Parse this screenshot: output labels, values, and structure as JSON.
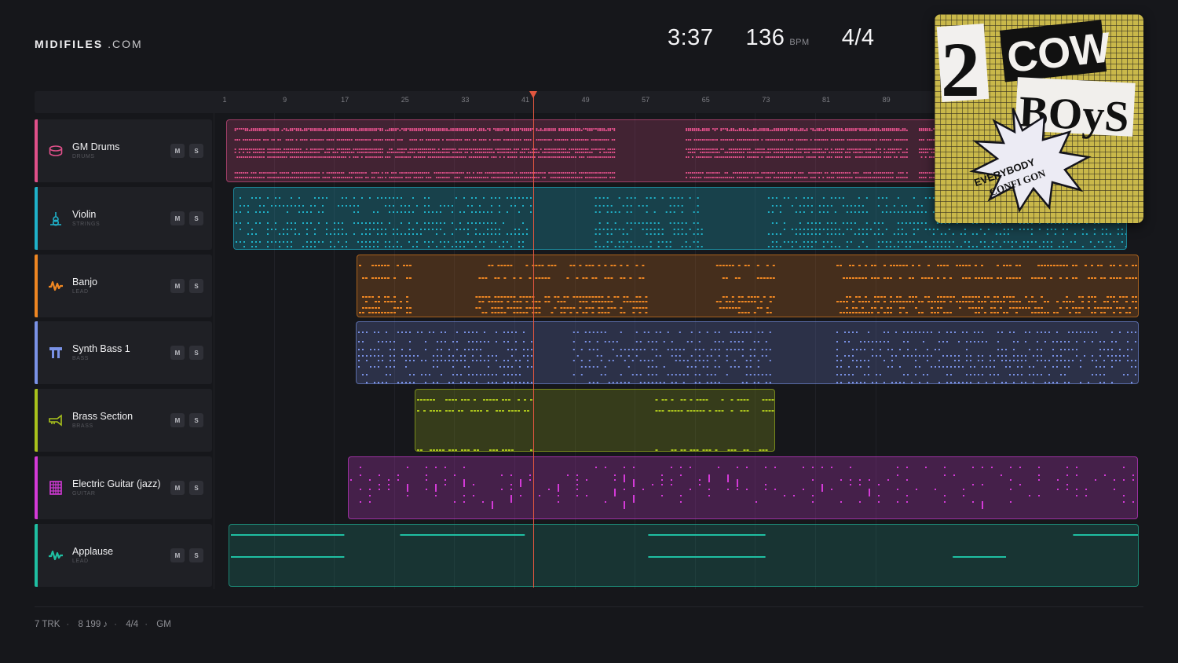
{
  "brand": {
    "name_bold": "MIDIFILES",
    "name_suffix": ".COM"
  },
  "stats": {
    "duration": "3:37",
    "tempo": "136",
    "tempo_unit": "BPM",
    "time_signature": "4/4"
  },
  "ruler": {
    "ticks": [
      "1",
      "9",
      "17",
      "25",
      "33",
      "41",
      "49",
      "57",
      "65",
      "73",
      "81",
      "89"
    ]
  },
  "tracks": [
    {
      "name": "GM Drums",
      "category": "DRUMS",
      "color": "#e0508a",
      "icon": "drum-icon",
      "mute": "M",
      "solo": "S"
    },
    {
      "name": "Violin",
      "category": "STRINGS",
      "color": "#1fb1c9",
      "icon": "violin-icon",
      "mute": "M",
      "solo": "S"
    },
    {
      "name": "Banjo",
      "category": "LEAD",
      "color": "#ee8622",
      "icon": "waveform-icon",
      "mute": "M",
      "solo": "S"
    },
    {
      "name": "Synth Bass 1",
      "category": "BASS",
      "color": "#7a92e6",
      "icon": "bass-icon",
      "mute": "M",
      "solo": "S"
    },
    {
      "name": "Brass Section",
      "category": "BRASS",
      "color": "#a9c21c",
      "icon": "trumpet-icon",
      "mute": "M",
      "solo": "S"
    },
    {
      "name": "Electric Guitar (jazz)",
      "category": "GUITAR",
      "color": "#d43ad8",
      "icon": "guitar-fretboard-icon",
      "mute": "M",
      "solo": "S"
    },
    {
      "name": "Applause",
      "category": "LEAD",
      "color": "#1fbfa2",
      "icon": "waveform-icon",
      "mute": "M",
      "solo": "S"
    }
  ],
  "playhead": {
    "bar": 42
  },
  "footer": {
    "tracks": "7 TRK",
    "notes": "8 199 ♪",
    "time_signature": "4/4",
    "standard": "GM"
  },
  "cover": {
    "line1": "2",
    "line2": "COW",
    "line3": "BOyS",
    "badge_line1": "EVERYBODY",
    "badge_line2": "CONFI GON"
  }
}
